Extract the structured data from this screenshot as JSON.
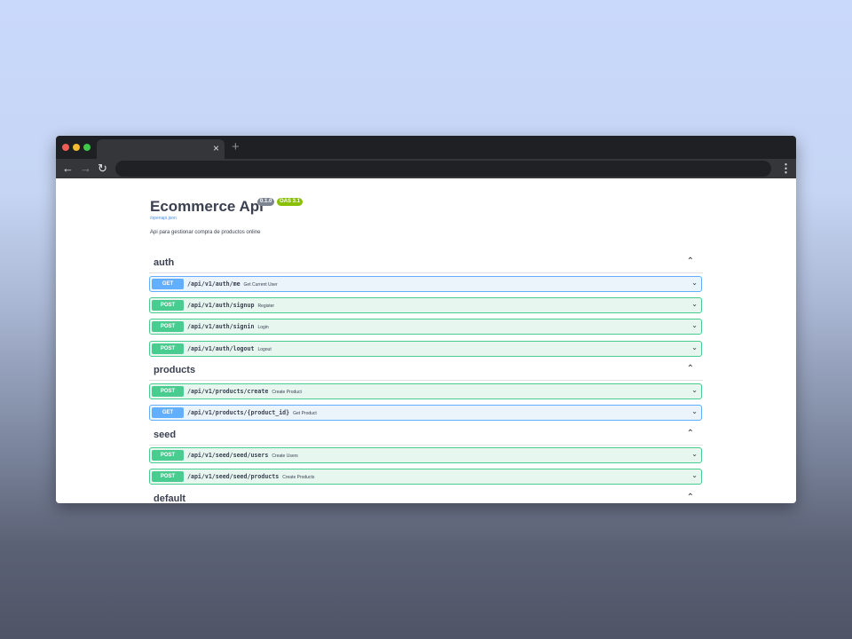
{
  "browser": {
    "tab_close": "×",
    "new_tab": "+",
    "back": "←",
    "forward": "→",
    "reload": "↻",
    "menu": "⋮",
    "url": ""
  },
  "api": {
    "title": "Ecommerce Api",
    "version": "0.1.0",
    "oas": "OAS 3.1",
    "spec_link": "/openapi.json",
    "description": "Api para gestionar compra de productos online"
  },
  "icons": {
    "collapse": "⌃",
    "expand": "⌄"
  },
  "tags": [
    {
      "name": "auth",
      "operations": [
        {
          "method": "GET",
          "path": "/api/v1/auth/me",
          "summary": "Get Current User"
        },
        {
          "method": "POST",
          "path": "/api/v1/auth/signup",
          "summary": "Register"
        },
        {
          "method": "POST",
          "path": "/api/v1/auth/signin",
          "summary": "Login"
        },
        {
          "method": "POST",
          "path": "/api/v1/auth/logout",
          "summary": "Logout"
        }
      ]
    },
    {
      "name": "products",
      "operations": [
        {
          "method": "POST",
          "path": "/api/v1/products/create",
          "summary": "Create Product"
        },
        {
          "method": "GET",
          "path": "/api/v1/products/{product_id}",
          "summary": "Get Product"
        }
      ]
    },
    {
      "name": "seed",
      "operations": [
        {
          "method": "POST",
          "path": "/api/v1/seed/seed/users",
          "summary": "Create Users"
        },
        {
          "method": "POST",
          "path": "/api/v1/seed/seed/products",
          "summary": "Create Products"
        }
      ]
    },
    {
      "name": "default",
      "operations": []
    }
  ]
}
